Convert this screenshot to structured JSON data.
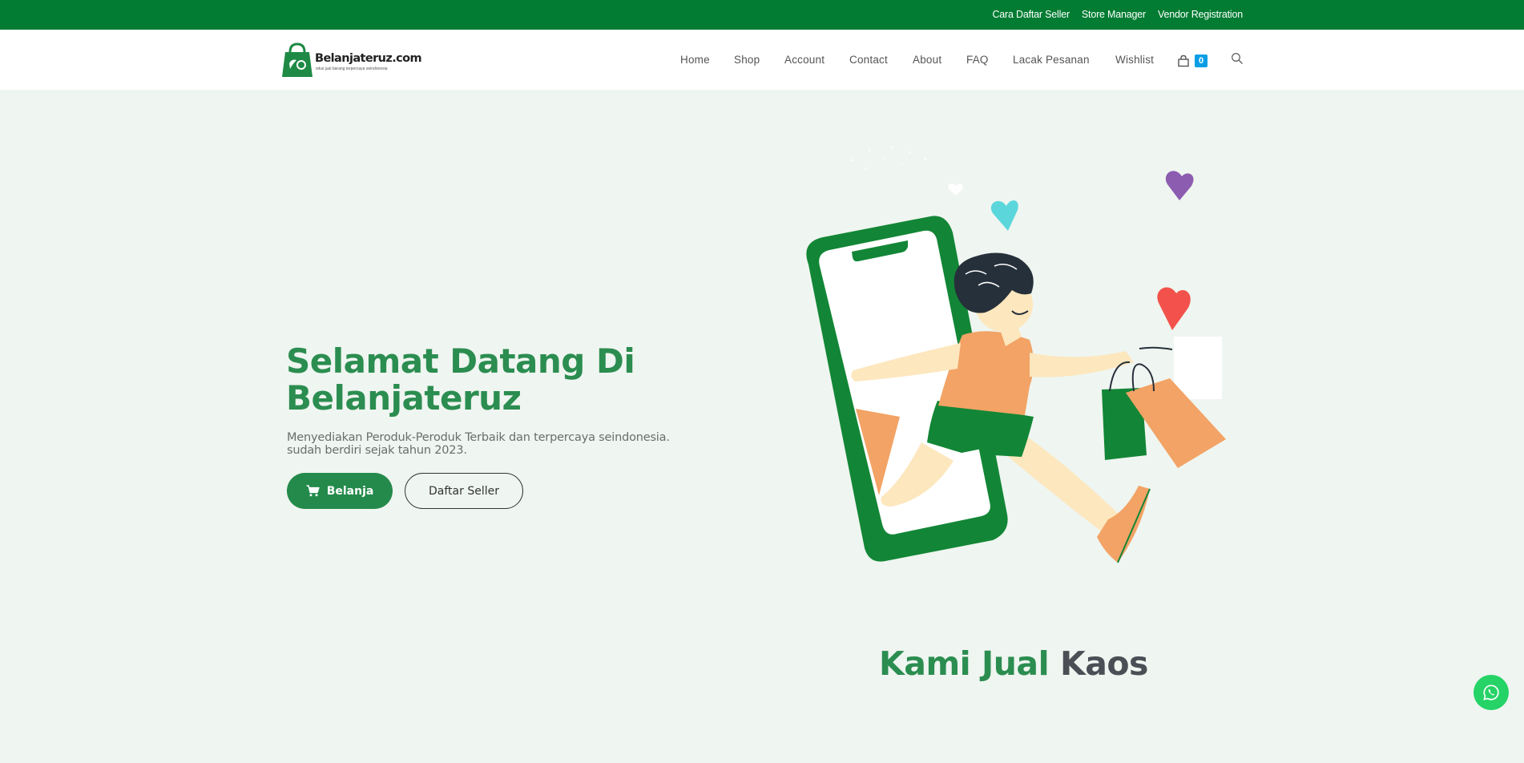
{
  "topbar": {
    "links": [
      "Cara Daftar Seller",
      "Store Manager",
      "Vendor Registration"
    ]
  },
  "header": {
    "logo_name": "Belanjateruz.com",
    "logo_tagline": "situs jual barang terpercaya seindonesia",
    "nav": [
      "Home",
      "Shop",
      "Account",
      "Contact",
      "About",
      "FAQ",
      "Lacak Pesanan",
      "Wishlist"
    ],
    "cart_count": "0"
  },
  "hero": {
    "title_line1": "Selamat Datang Di",
    "title_line2": "Belanjateruz",
    "desc_line1": "Menyediakan Peroduk-Peroduk Terbaik dan terpercaya seindonesia.",
    "desc_line2": "sudah berdiri sejak tahun 2023.",
    "btn_shop": "Belanja",
    "btn_seller": "Daftar Seller"
  },
  "section": {
    "heading_green": "Kami Jual",
    "heading_dark": "Kaos"
  },
  "icons": {
    "cart": "cart-icon",
    "search": "search-icon",
    "shop_button": "shopping-cart-icon",
    "whatsapp": "whatsapp-icon"
  },
  "colors": {
    "topbar": "#017c32",
    "brand_green": "#2b8d50",
    "button_green": "#248a4c",
    "badge_blue": "#0b9ee4",
    "page_bg": "#eff5f0",
    "whatsapp": "#25d366"
  }
}
